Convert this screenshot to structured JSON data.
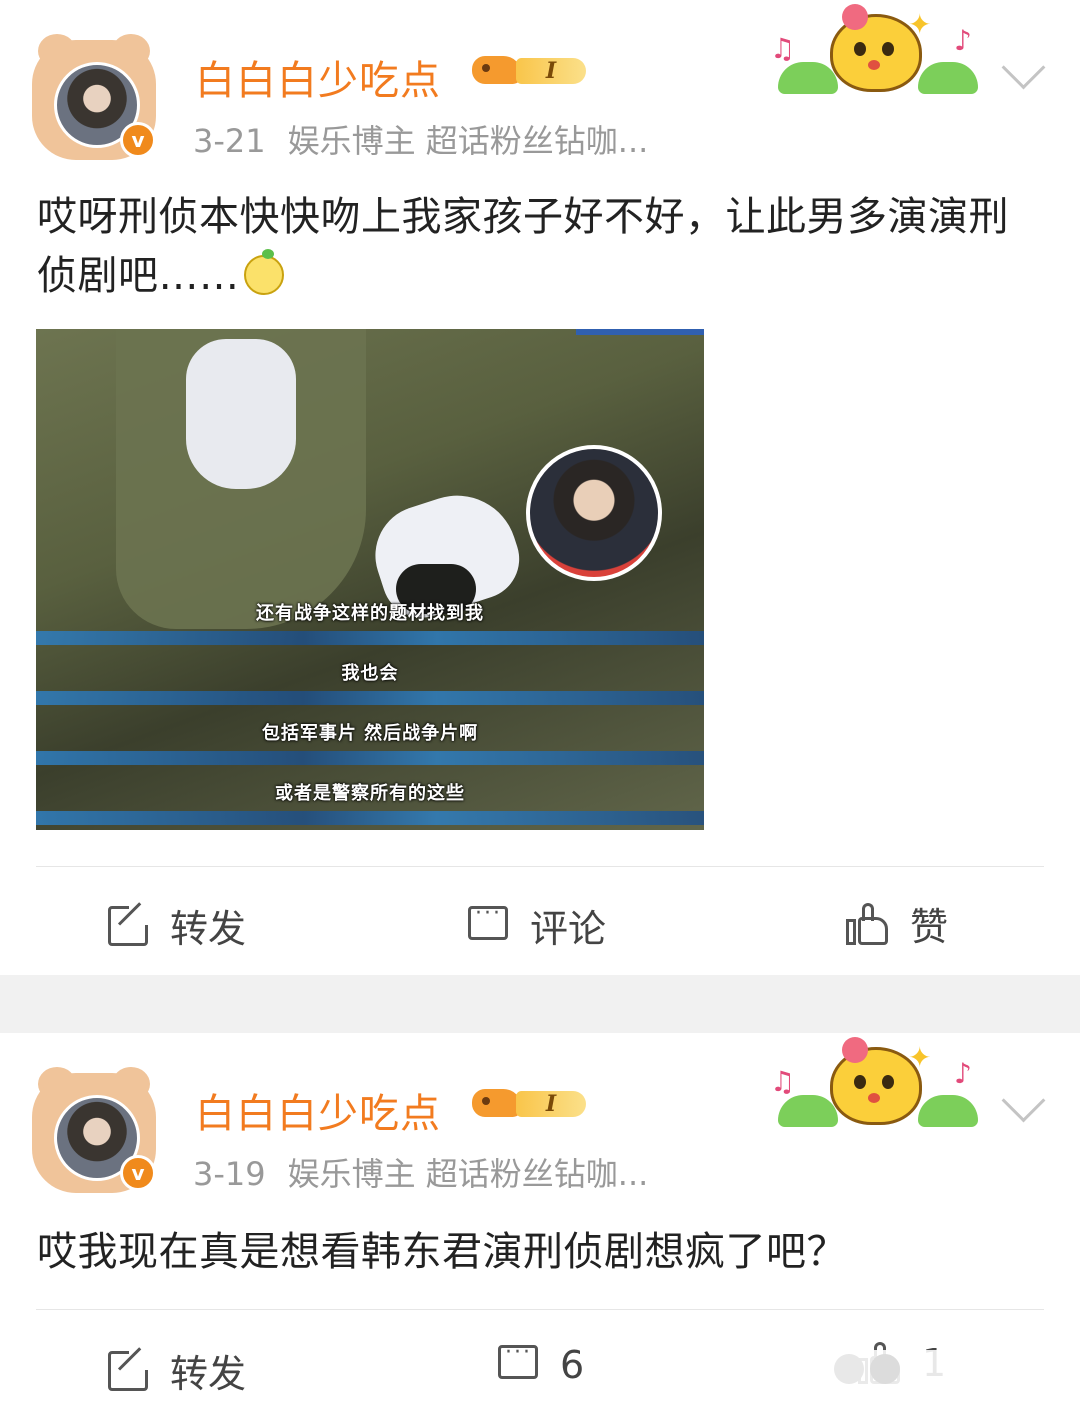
{
  "posts": [
    {
      "username": "白白白少吃点",
      "rank": "I",
      "date": "3-21",
      "source": "娱乐博主 超话粉丝钻咖...",
      "content": "哎呀刑侦本快快吻上我家孩子好不好，让此男多演演刑侦剧吧……",
      "media_subtitles": [
        "还有战争这样的题材找到我",
        "我也会",
        "包括军事片 然后战争片啊",
        "或者是警察所有的这些"
      ],
      "actions": {
        "repost": "转发",
        "comment": "评论",
        "like": "赞"
      }
    },
    {
      "username": "白白白少吃点",
      "rank": "I",
      "date": "3-19",
      "source": "娱乐博主 超话粉丝钻咖...",
      "content": "哎我现在真是想看韩东君演刑侦剧想疯了吧？",
      "actions": {
        "repost": "转发",
        "comment": "6",
        "like": "1"
      }
    }
  ],
  "colors": {
    "username": "#f27b1f",
    "verified_badge": "#f08a1c",
    "separator": "#f1f1f1"
  },
  "icons": [
    "avatar",
    "verified-v-icon",
    "rank-bird-icon",
    "decoration-sticker",
    "chevron-down-icon",
    "repost-icon",
    "comment-icon",
    "like-icon"
  ]
}
